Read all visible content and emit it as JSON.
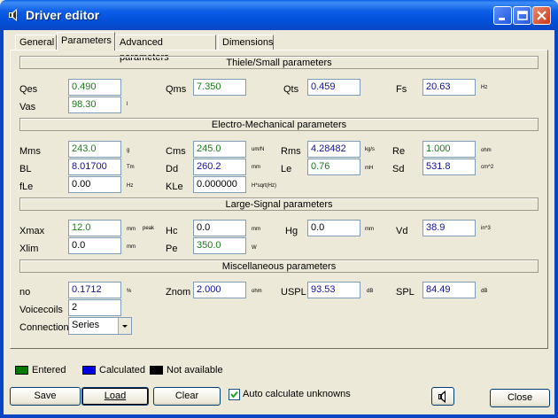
{
  "window": {
    "title": "Driver editor"
  },
  "tabs": [
    {
      "label": "General"
    },
    {
      "label": "Parameters"
    },
    {
      "label": "Advanced parameters"
    },
    {
      "label": "Dimensions"
    }
  ],
  "sections": {
    "ts": "Thiele/Small parameters",
    "em": "Electro-Mechanical parameters",
    "ls": "Large-Signal parameters",
    "misc": "Miscellaneous parameters"
  },
  "params": {
    "qes": {
      "label": "Qes",
      "value": "0.490"
    },
    "qms": {
      "label": "Qms",
      "value": "7.350"
    },
    "qts": {
      "label": "Qts",
      "value": "0.459"
    },
    "fs": {
      "label": "Fs",
      "value": "20.63",
      "unit": "Hz"
    },
    "vas": {
      "label": "Vas",
      "value": "98.30",
      "unit": "l"
    },
    "mms": {
      "label": "Mms",
      "value": "243.0",
      "unit": "g"
    },
    "cms": {
      "label": "Cms",
      "value": "245.0",
      "unit": "um/N"
    },
    "rms": {
      "label": "Rms",
      "value": "4.28482",
      "unit": "kg/s"
    },
    "re": {
      "label": "Re",
      "value": "1.000",
      "unit": "ohm"
    },
    "bl": {
      "label": "BL",
      "value": "8.01700",
      "unit": "Tm"
    },
    "dd": {
      "label": "Dd",
      "value": "260.2",
      "unit": "mm"
    },
    "le": {
      "label": "Le",
      "value": "0.76",
      "unit": "mH"
    },
    "sd": {
      "label": "Sd",
      "value": "531.8",
      "unit": "cm^2"
    },
    "fle": {
      "label": "fLe",
      "value": "0.00",
      "unit": "Hz"
    },
    "kle": {
      "label": "KLe",
      "value": "0.000000",
      "unit": "H*sqrt(Hz)"
    },
    "xmax": {
      "label": "Xmax",
      "value": "12.0",
      "unit": "mm",
      "extra": "peak"
    },
    "hc": {
      "label": "Hc",
      "value": "0.0",
      "unit": "mm"
    },
    "hg": {
      "label": "Hg",
      "value": "0.0",
      "unit": "mm"
    },
    "vd": {
      "label": "Vd",
      "value": "38.9",
      "unit": "in^3"
    },
    "xlim": {
      "label": "Xlim",
      "value": "0.0",
      "unit": "mm"
    },
    "pe": {
      "label": "Pe",
      "value": "350.0",
      "unit": "W"
    },
    "no": {
      "label": "no",
      "value": "0.1712",
      "unit": "%"
    },
    "znom": {
      "label": "Znom",
      "value": "2.000",
      "unit": "ohm"
    },
    "uspl": {
      "label": "USPL",
      "value": "93.53",
      "unit": "dB"
    },
    "spl": {
      "label": "SPL",
      "value": "84.49",
      "unit": "dB"
    },
    "voicecoils": {
      "label": "Voicecoils",
      "value": "2"
    },
    "connection": {
      "label": "Connection",
      "value": "Series"
    }
  },
  "legend": {
    "entered": {
      "label": "Entered",
      "color": "#007800"
    },
    "calculated": {
      "label": "Calculated",
      "color": "#0000e0"
    },
    "na": {
      "label": "Not available",
      "color": "#000000"
    }
  },
  "buttons": {
    "save": "Save",
    "load": "Load",
    "clear": "Clear",
    "auto": "Auto calculate unknowns",
    "close": "Close"
  }
}
